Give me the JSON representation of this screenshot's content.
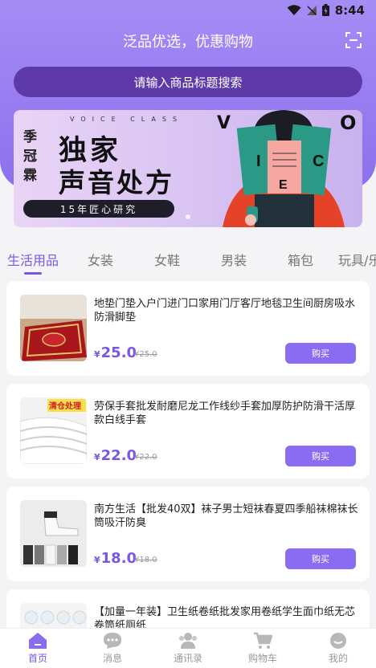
{
  "status_bar": {
    "time": "8:44"
  },
  "header": {
    "title": "泛品优选，优惠购物",
    "search_placeholder": "请输入商品标题搜索",
    "scan_icon": "scan-icon"
  },
  "banner": {
    "voice_text": "VOICE CLASS",
    "vertical_text": "季冠霖",
    "line1": "独家",
    "line2": "声音处方",
    "pill": "15年匠心研究",
    "letter_v": "V",
    "letter_o": "O",
    "book_letters": [
      "I",
      "C",
      "E"
    ]
  },
  "tabs": [
    "生活用品",
    "女装",
    "女鞋",
    "男装",
    "箱包",
    "玩具/乐"
  ],
  "active_tab": 0,
  "accent_color": "#7a56e6",
  "products": [
    {
      "name": "地垫门垫入户门进门口家用门厅客厅地毯卫生间厨房吸水防滑脚垫",
      "currency": "¥",
      "price": "25.0",
      "old_price": "¥25.0",
      "buy_label": "购买"
    },
    {
      "name": "劳保手套批发耐磨尼龙工作线纱手套加厚防护防滑干活厚款白线手套",
      "currency": "¥",
      "price": "22.0",
      "old_price": "¥22.0",
      "buy_label": "购买",
      "thumb_tag": "清仓处理"
    },
    {
      "name": "南方生活【批发40双】袜子男士短袜春夏四季船袜棉袜长筒吸汗防臭",
      "currency": "¥",
      "price": "18.0",
      "old_price": "¥18.0",
      "buy_label": "购买"
    },
    {
      "name": "【加量一年装】卫生纸卷纸批发家用卷纸学生面巾纸无芯卷筒纸厕纸",
      "currency": "¥",
      "price": "",
      "old_price": "",
      "buy_label": ""
    }
  ],
  "bottom_nav": [
    {
      "label": "首页",
      "icon": "home-icon"
    },
    {
      "label": "消息",
      "icon": "message-icon"
    },
    {
      "label": "通讯录",
      "icon": "contacts-icon"
    },
    {
      "label": "购物车",
      "icon": "cart-icon"
    },
    {
      "label": "我的",
      "icon": "profile-icon"
    }
  ]
}
